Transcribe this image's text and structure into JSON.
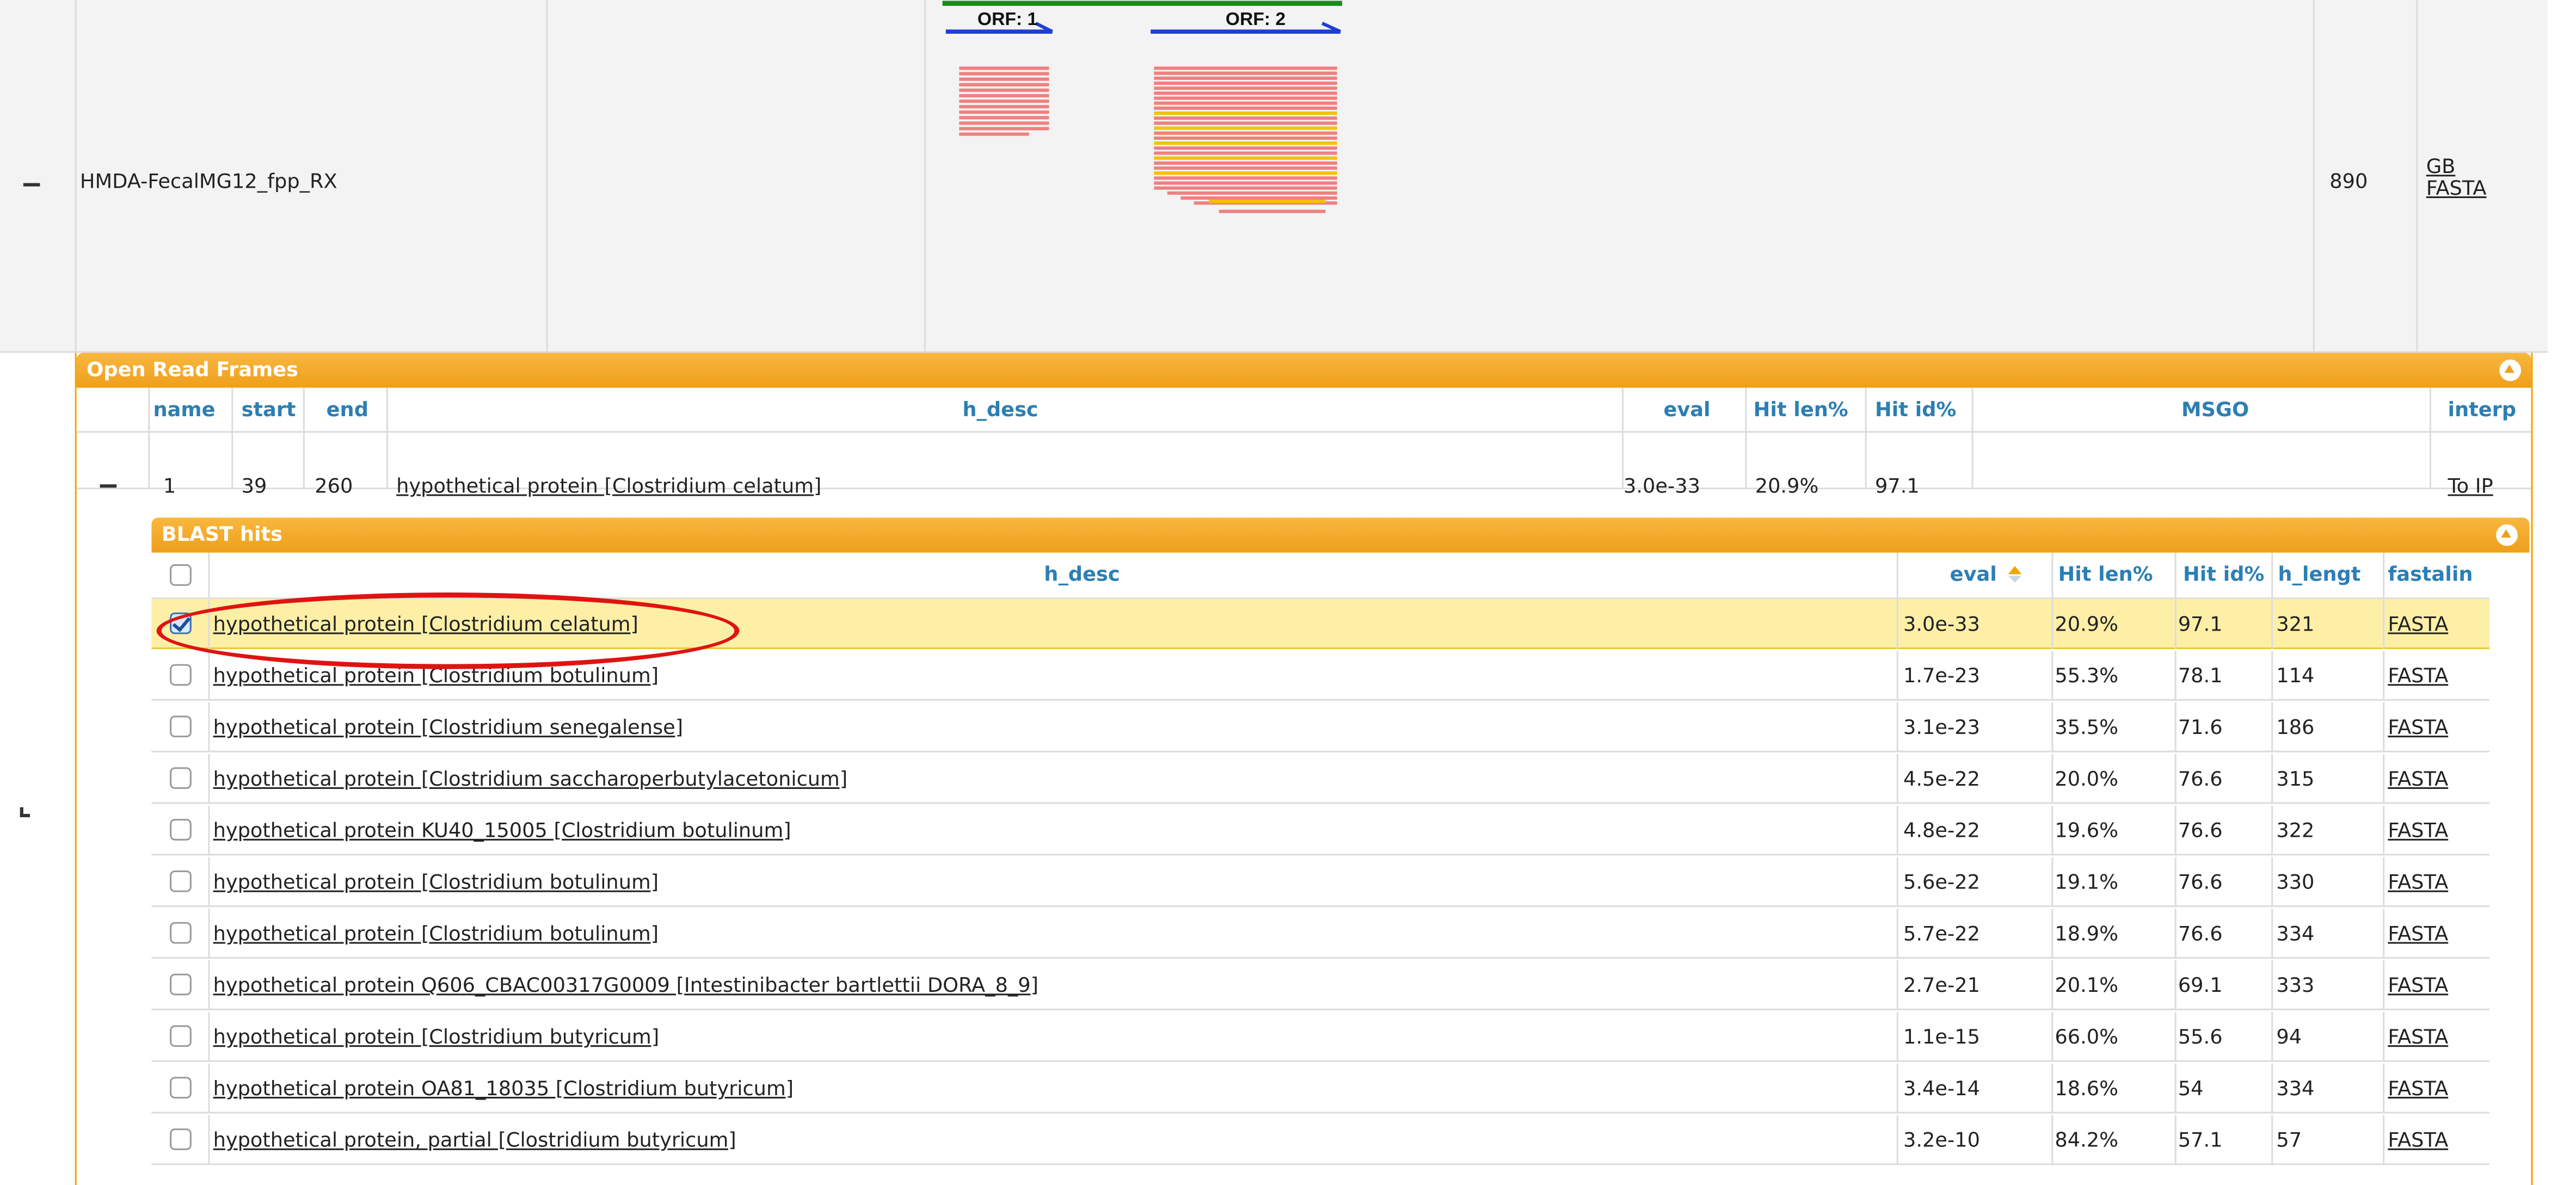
{
  "contig": {
    "name": "HMDA-FecalMG12_fpp_RX",
    "length": "890",
    "links": [
      "GB",
      "FASTA"
    ],
    "orf_labels": [
      "ORF: 1",
      "ORF: 2"
    ]
  },
  "orf_panel": {
    "title": "Open Read Frames",
    "columns": [
      "name",
      "start",
      "end",
      "h_desc",
      "eval",
      "Hit len%",
      "Hit id%",
      "MSGO",
      "interp"
    ],
    "row": {
      "name": "1",
      "start": "39",
      "end": "260",
      "h_desc": "hypothetical protein [Clostridium celatum]",
      "eval": "3.0e-33",
      "hit_len": "20.9%",
      "hit_id": "97.1",
      "msgo": "",
      "interp": "To IP"
    }
  },
  "blast_panel": {
    "title": "BLAST hits",
    "columns": [
      "h_desc",
      "eval",
      "Hit len%",
      "Hit id%",
      "h_lengt",
      "fastalin"
    ],
    "rows": [
      {
        "desc": "hypothetical protein [Clostridium celatum]",
        "eval": "3.0e-33",
        "hit_len": "20.9%",
        "hit_id": "97.1",
        "h_length": "321",
        "fasta": "FASTA",
        "checked": true
      },
      {
        "desc": "hypothetical protein [Clostridium botulinum]",
        "eval": "1.7e-23",
        "hit_len": "55.3%",
        "hit_id": "78.1",
        "h_length": "114",
        "fasta": "FASTA",
        "checked": false
      },
      {
        "desc": "hypothetical protein [Clostridium senegalense]",
        "eval": "3.1e-23",
        "hit_len": "35.5%",
        "hit_id": "71.6",
        "h_length": "186",
        "fasta": "FASTA",
        "checked": false
      },
      {
        "desc": "hypothetical protein [Clostridium saccharoperbutylacetonicum]",
        "eval": "4.5e-22",
        "hit_len": "20.0%",
        "hit_id": "76.6",
        "h_length": "315",
        "fasta": "FASTA",
        "checked": false
      },
      {
        "desc": "hypothetical protein KU40_15005 [Clostridium botulinum]",
        "eval": "4.8e-22",
        "hit_len": "19.6%",
        "hit_id": "76.6",
        "h_length": "322",
        "fasta": "FASTA",
        "checked": false
      },
      {
        "desc": "hypothetical protein [Clostridium botulinum]",
        "eval": "5.6e-22",
        "hit_len": "19.1%",
        "hit_id": "76.6",
        "h_length": "330",
        "fasta": "FASTA",
        "checked": false
      },
      {
        "desc": "hypothetical protein [Clostridium botulinum]",
        "eval": "5.7e-22",
        "hit_len": "18.9%",
        "hit_id": "76.6",
        "h_length": "334",
        "fasta": "FASTA",
        "checked": false
      },
      {
        "desc": "hypothetical protein Q606_CBAC00317G0009 [Intestinibacter bartlettii DORA_8_9]",
        "eval": "2.7e-21",
        "hit_len": "20.1%",
        "hit_id": "69.1",
        "h_length": "333",
        "fasta": "FASTA",
        "checked": false
      },
      {
        "desc": "hypothetical protein [Clostridium butyricum]",
        "eval": "1.1e-15",
        "hit_len": "66.0%",
        "hit_id": "55.6",
        "h_length": "94",
        "fasta": "FASTA",
        "checked": false
      },
      {
        "desc": "hypothetical protein OA81_18035 [Clostridium butyricum]",
        "eval": "3.4e-14",
        "hit_len": "18.6%",
        "hit_id": "54",
        "h_length": "334",
        "fasta": "FASTA",
        "checked": false
      },
      {
        "desc": "hypothetical protein, partial [Clostridium butyricum]",
        "eval": "3.2e-10",
        "hit_len": "84.2%",
        "hit_id": "57.1",
        "h_length": "57",
        "fasta": "FASTA",
        "checked": false
      }
    ]
  },
  "colors": {
    "accent": "#ef9f1b",
    "header_text": "#2b7fb5",
    "selected_row": "#fdf0a6",
    "annotation_oval": "#e01313",
    "hit_bar": "#f08080",
    "hit_bar_highlight": "#f2c200",
    "orf_line": "#1f3fd1",
    "genome_line": "#1a8a1a"
  }
}
